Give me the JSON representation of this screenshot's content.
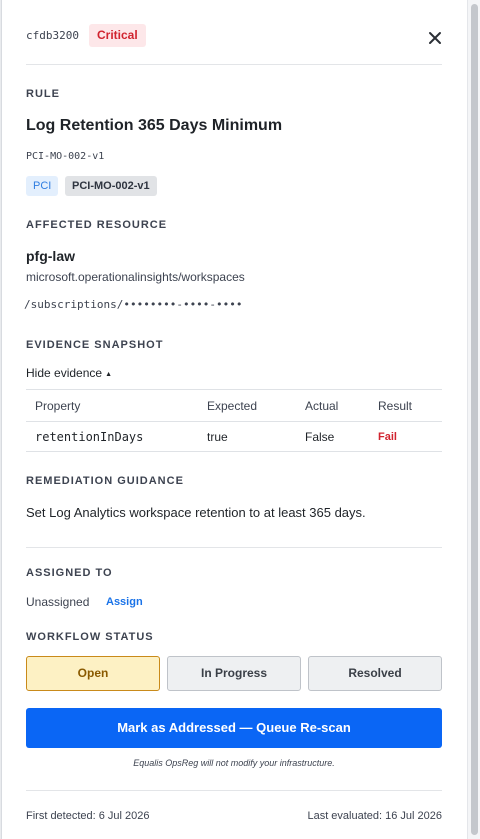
{
  "header": {
    "finding_id": "cfdb3200",
    "severity": "Critical"
  },
  "rule": {
    "section_label": "RULE",
    "title": "Log Retention 365 Days Minimum",
    "rule_id": "PCI-MO-002-v1",
    "framework_tag": "PCI",
    "control_tag": "PCI-MO-002-v1"
  },
  "resource": {
    "section_label": "AFFECTED RESOURCE",
    "name": "pfg-law",
    "type": "microsoft.operationalinsights/workspaces",
    "path": "/subscriptions/••••••••-••••-••••"
  },
  "evidence": {
    "section_label": "EVIDENCE SNAPSHOT",
    "toggle_label": "Hide evidence",
    "columns": [
      "Property",
      "Expected",
      "Actual",
      "Result"
    ],
    "rows": [
      {
        "property": "retentionInDays",
        "expected": "true",
        "actual": "False",
        "result": "Fail"
      }
    ]
  },
  "remediation": {
    "section_label": "REMEDIATION GUIDANCE",
    "text": "Set Log Analytics workspace retention to at least 365 days."
  },
  "assignment": {
    "section_label": "ASSIGNED TO",
    "value": "Unassigned",
    "assign_label": "Assign"
  },
  "workflow": {
    "section_label": "WORKFLOW STATUS",
    "options": [
      "Open",
      "In Progress",
      "Resolved"
    ],
    "selected": "Open"
  },
  "actions": {
    "primary_label": "Mark as Addressed — Queue Re-scan",
    "disclaimer": "Equalis OpsReg will not modify your infrastructure."
  },
  "footer": {
    "first_detected": "First detected: 6 Jul 2026",
    "last_evaluated": "Last evaluated: 16 Jul 2026"
  },
  "colors": {
    "critical": "#d1242f",
    "primary": "#0a66f5",
    "selected_status": "#fdf1c4",
    "link": "#1a73e8"
  }
}
